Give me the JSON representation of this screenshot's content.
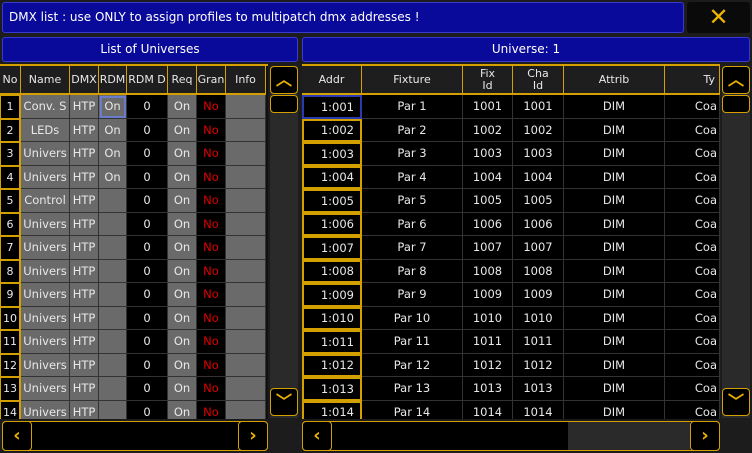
{
  "title": "DMX list : use ONLY to assign profiles to multipatch dmx addresses !",
  "close_icon": "close-x-icon",
  "left": {
    "header": "List of Universes",
    "columns": [
      "No",
      "Name",
      "DMX",
      "RDM",
      "RDM D",
      "Req",
      "Gran",
      "Info"
    ],
    "rows": [
      [
        "1",
        "Conv. S",
        "HTP",
        "On",
        "0",
        "On",
        "No",
        ""
      ],
      [
        "2",
        "LEDs",
        "HTP",
        "On",
        "0",
        "On",
        "No",
        ""
      ],
      [
        "3",
        "Univers",
        "HTP",
        "On",
        "0",
        "On",
        "No",
        ""
      ],
      [
        "4",
        "Univers",
        "HTP",
        "On",
        "0",
        "On",
        "No",
        ""
      ],
      [
        "5",
        "Control",
        "HTP",
        "",
        "0",
        "On",
        "No",
        ""
      ],
      [
        "6",
        "Univers",
        "HTP",
        "",
        "0",
        "On",
        "No",
        ""
      ],
      [
        "7",
        "Univers",
        "HTP",
        "",
        "0",
        "On",
        "No",
        ""
      ],
      [
        "8",
        "Univers",
        "HTP",
        "",
        "0",
        "On",
        "No",
        ""
      ],
      [
        "9",
        "Univers",
        "HTP",
        "",
        "0",
        "On",
        "No",
        ""
      ],
      [
        "10",
        "Univers",
        "HTP",
        "",
        "0",
        "On",
        "No",
        ""
      ],
      [
        "11",
        "Univers",
        "HTP",
        "",
        "0",
        "On",
        "No",
        ""
      ],
      [
        "12",
        "Univers",
        "HTP",
        "",
        "0",
        "On",
        "No",
        ""
      ],
      [
        "13",
        "Univers",
        "HTP",
        "",
        "0",
        "On",
        "No",
        ""
      ],
      [
        "14",
        "Univers",
        "HTP",
        "",
        "0",
        "On",
        "No",
        ""
      ]
    ]
  },
  "right": {
    "header": "Universe: 1",
    "columns": [
      "Addr",
      "Fixture",
      "Fix\nId",
      "Cha\nId",
      "Attrib",
      "Ty"
    ],
    "rows": [
      [
        "1:001",
        "Par 1",
        "1001",
        "1001",
        "DIM",
        "Coa"
      ],
      [
        "1:002",
        "Par 2",
        "1002",
        "1002",
        "DIM",
        "Coa"
      ],
      [
        "1:003",
        "Par 3",
        "1003",
        "1003",
        "DIM",
        "Coa"
      ],
      [
        "1:004",
        "Par 4",
        "1004",
        "1004",
        "DIM",
        "Coa"
      ],
      [
        "1:005",
        "Par 5",
        "1005",
        "1005",
        "DIM",
        "Coa"
      ],
      [
        "1:006",
        "Par 6",
        "1006",
        "1006",
        "DIM",
        "Coa"
      ],
      [
        "1:007",
        "Par 7",
        "1007",
        "1007",
        "DIM",
        "Coa"
      ],
      [
        "1:008",
        "Par 8",
        "1008",
        "1008",
        "DIM",
        "Coa"
      ],
      [
        "1:009",
        "Par 9",
        "1009",
        "1009",
        "DIM",
        "Coa"
      ],
      [
        "1:010",
        "Par 10",
        "1010",
        "1010",
        "DIM",
        "Coa"
      ],
      [
        "1:011",
        "Par 11",
        "1011",
        "1011",
        "DIM",
        "Coa"
      ],
      [
        "1:012",
        "Par 12",
        "1012",
        "1012",
        "DIM",
        "Coa"
      ],
      [
        "1:013",
        "Par 13",
        "1013",
        "1013",
        "DIM",
        "Coa"
      ],
      [
        "1:014",
        "Par 14",
        "1014",
        "1014",
        "DIM",
        "Coa"
      ]
    ]
  },
  "icons": {
    "up": "^",
    "down": "v",
    "left": "<",
    "right": ">"
  },
  "colors": {
    "accent": "#d4a000",
    "title_bg": "#0a0a9a",
    "no_red": "#e00000"
  }
}
